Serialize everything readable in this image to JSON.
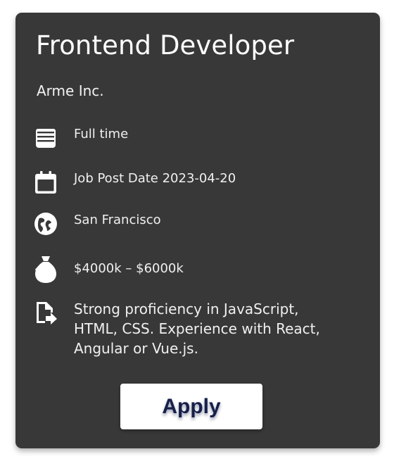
{
  "job": {
    "title": "Frontend Developer",
    "company": "Arme Inc.",
    "details": [
      {
        "icon": "document-stack-icon",
        "text": "Full time"
      },
      {
        "icon": "calendar-icon",
        "text": "Job Post Date 2023-04-20"
      },
      {
        "icon": "globe-icon",
        "text": "San Francisco"
      },
      {
        "icon": "money-bag-icon",
        "text": "$4000k – $6000k"
      },
      {
        "icon": "document-arrow-icon",
        "text": "Strong proficiency in JavaScript, HTML, CSS. Experience with React, Angular or Vue.js."
      }
    ],
    "apply_label": "Apply"
  },
  "colors": {
    "card_background": "#383838",
    "text": "#ffffff",
    "button_background": "#ffffff",
    "button_text": "#16204a"
  }
}
